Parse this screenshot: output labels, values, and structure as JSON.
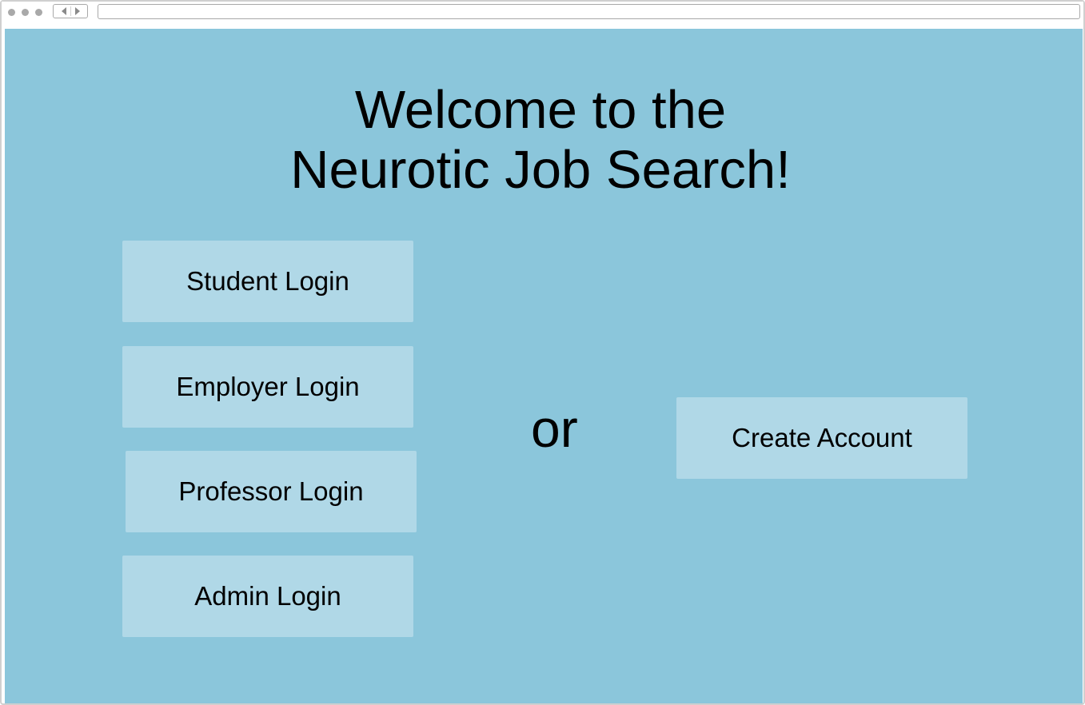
{
  "title_line1": "Welcome to the",
  "title_line2": "Neurotic Job Search!",
  "login_buttons": {
    "student": "Student Login",
    "employer": "Employer Login",
    "professor": "Professor Login",
    "admin": "Admin Login"
  },
  "separator": "or",
  "create_account": "Create Account",
  "colors": {
    "background": "#8bc6db",
    "button": "#b0d8e7",
    "text": "#000000"
  }
}
